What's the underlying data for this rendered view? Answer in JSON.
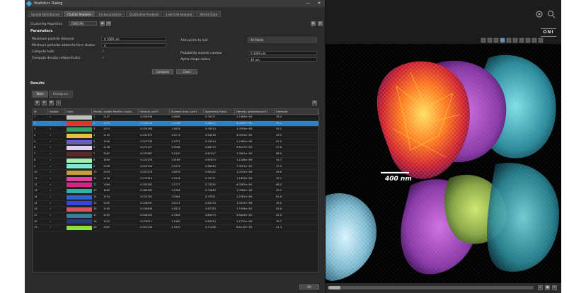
{
  "window": {
    "title": "Statistics Dialog",
    "minimize": "—",
    "close": "✕"
  },
  "tabs": [
    "Spatial Distribution",
    "Cluster Analysis",
    "Co-Localization",
    "Qualitative Analysis",
    "Live Cell Analysis",
    "Vertex Data"
  ],
  "clustering": {
    "label": "Clustering Algorithm",
    "value": "DBSCAN"
  },
  "parameters": {
    "title": "Parameters",
    "max_particle_distance_label": "Maximum particle distance",
    "max_particle_distance_value": "0.1000 um",
    "min_particles_label": "Minimum particles added to form cluster",
    "min_particles_value": "4",
    "compute_hulls_label": "Compute hulls",
    "compute_density_label": "Compute density (ellipse/hulls)",
    "add_points_label": "Add points to hull",
    "add_points_value": "All Points",
    "probability_label": "Probability outside contour",
    "probability_value": "0.1000 um",
    "alpha_label": "Alpha shape radius",
    "alpha_value": "40 nm",
    "compute_button": "Compute",
    "clear_button": "Clear"
  },
  "results": {
    "title": "Results",
    "subtabs": [
      "Table",
      "Histogram"
    ],
    "columns": [
      "ID",
      "Visible",
      "Color",
      "Points",
      "Visible Particle Count",
      "Volume (um³)",
      "Surface Area (um²)",
      "Sphericity Ratio",
      "Density (particles/um³)",
      "Centroid"
    ],
    "rows": [
      {
        "id": "1",
        "vis": "✓",
        "color": "#bfbfbf",
        "points": "1",
        "count": "1107",
        "vol": "0.009438",
        "area": "1.8808",
        "sph": "0.78271",
        "dens": "1.1869e+06",
        "cen": "78.4"
      },
      {
        "id": "2",
        "vis": "✓",
        "color": "#e03030",
        "points": "2",
        "count": "1010",
        "vol": "0.018376",
        "area": "1.0148",
        "sph": "0.68212",
        "dens": "6.0063e+05",
        "cen": "92.1"
      },
      {
        "id": "3",
        "vis": "✓",
        "color": "#2fa860",
        "points": "3",
        "count": "1015",
        "vol": "0.054188",
        "area": "1.4619",
        "sph": "0.78014",
        "dens": "1.0393e+06",
        "cen": "56.2"
      },
      {
        "id": "4",
        "vis": "✓",
        "color": "#e8c040",
        "points": "4",
        "count": "1159",
        "vol": "0.031379",
        "area": "1.0173",
        "sph": "0.56016",
        "dens": "4.9951e+05",
        "cen": "43.5"
      },
      {
        "id": "5",
        "vis": "✓",
        "color": "#6a5fc0",
        "points": "5",
        "count": "1046",
        "vol": "0.020128",
        "area": "1.3721",
        "sph": "0.76514",
        "dens": "1.2480e+06",
        "cen": "61.0"
      },
      {
        "id": "6",
        "vis": "✓",
        "color": "#e0d0f0",
        "points": "6",
        "count": "1108",
        "vol": "0.071127",
        "area": "1.0048",
        "sph": "0.68175",
        "dens": "9.8417e+05",
        "cen": "27.6"
      },
      {
        "id": "7",
        "vis": "✓",
        "color": "#5a2a2a",
        "points": "7",
        "count": "1061",
        "vol": "0.037687",
        "area": "1.2410",
        "sph": "0.81057",
        "dens": "1.3601e+06",
        "cen": "88.9"
      },
      {
        "id": "8",
        "vis": "✓",
        "color": "#a0f0b0",
        "points": "8",
        "count": "1856",
        "vol": "0.025376",
        "area": "1.8169",
        "sph": "0.67873",
        "dens": "1.1408e+06",
        "cen": "34.7"
      },
      {
        "id": "9",
        "vis": "✓",
        "color": "#7ee8d0",
        "points": "9",
        "count": "1046",
        "vol": "0.023754",
        "area": "1.9373",
        "sph": "0.66543",
        "dens": "7.3521e+05",
        "cen": "72.3"
      },
      {
        "id": "10",
        "vis": "✓",
        "color": "#c89a40",
        "points": "10",
        "count": "1043",
        "vol": "0.041278",
        "area": "1.8676",
        "sph": "0.68182",
        "dens": "1.0251e+06",
        "cen": "49.8"
      },
      {
        "id": "11",
        "vis": "✓",
        "color": "#e040a0",
        "points": "11",
        "count": "1136",
        "vol": "0.079314",
        "area": "1.2018",
        "sph": "0.76771",
        "dens": "1.1853e+06",
        "cen": "55.1"
      },
      {
        "id": "12",
        "vis": "✓",
        "color": "#e02080",
        "points": "12",
        "count": "1084",
        "vol": "0.035362",
        "area": "1.2777",
        "sph": "0.73555",
        "dens": "6.3287e+05",
        "cen": "68.4"
      },
      {
        "id": "13",
        "vis": "✓",
        "color": "#30b0a0",
        "points": "13",
        "count": "1889",
        "vol": "0.086362",
        "area": "1.4764",
        "sph": "0.70649",
        "dens": "1.0982e+06",
        "cen": "39.2"
      },
      {
        "id": "14",
        "vis": "✓",
        "color": "#2f60d0",
        "points": "14",
        "count": "1314",
        "vol": "0.023762",
        "area": "1.0564",
        "sph": "0.79351",
        "dens": "1.2961e+06",
        "cen": "81.6"
      },
      {
        "id": "15",
        "vis": "✓",
        "color": "#4040e0",
        "points": "15",
        "count": "1032",
        "vol": "0.026091",
        "area": "1.8727",
        "sph": "0.60733",
        "dens": "1.0047e+06",
        "cen": "45.5"
      },
      {
        "id": "16",
        "vis": "✓",
        "color": "#e05060",
        "points": "16",
        "count": "1160",
        "vol": "0.030808",
        "area": "1.0813",
        "sph": "0.65763",
        "dens": "7.7956e+05",
        "cen": "63.8"
      },
      {
        "id": "17",
        "vis": "✓",
        "color": "#3a7a9a",
        "points": "17",
        "count": "1092",
        "vol": "0.046102",
        "area": "1.7643",
        "sph": "0.80573",
        "dens": "9.4823e+05",
        "cen": "52.0"
      },
      {
        "id": "18",
        "vis": "✓",
        "color": "#2a3a70",
        "points": "18",
        "count": "1012",
        "vol": "0.076511",
        "area": "1.1089",
        "sph": "0.60974",
        "dens": "1.1270e+06",
        "cen": "76.7"
      },
      {
        "id": "19",
        "vis": "✓",
        "color": "#90e040",
        "points": "19",
        "count": "1067",
        "vol": "0.051234",
        "area": "1.3310",
        "sph": "0.71208",
        "dens": "8.8110e+05",
        "cen": "41.3"
      }
    ]
  },
  "viewer": {
    "scale_label": "400 nm",
    "brand": "ONI",
    "slider_fraction": 0.06
  },
  "ok_button": "OK"
}
